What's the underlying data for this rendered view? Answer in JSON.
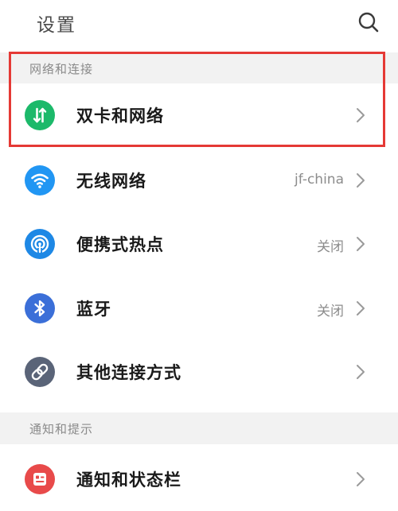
{
  "header": {
    "title": "设置",
    "search_icon": "search-icon"
  },
  "sections": [
    {
      "title": "网络和连接",
      "items": [
        {
          "label": "双卡和网络",
          "value": "",
          "icon": "dual-sim-data-icon",
          "icon_color": "#1cb96a"
        },
        {
          "label": "无线网络",
          "value": "jf-china",
          "icon": "wifi-icon",
          "icon_color": "#2196f3"
        },
        {
          "label": "便携式热点",
          "value": "关闭",
          "icon": "hotspot-icon",
          "icon_color": "#1e88e5"
        },
        {
          "label": "蓝牙",
          "value": "关闭",
          "icon": "bluetooth-icon",
          "icon_color": "#3b6fd8"
        },
        {
          "label": "其他连接方式",
          "value": "",
          "icon": "link-icon",
          "icon_color": "#5a6478"
        }
      ]
    },
    {
      "title": "通知和提示",
      "items": [
        {
          "label": "通知和状态栏",
          "value": "",
          "icon": "notification-icon",
          "icon_color": "#e84a4a"
        }
      ]
    }
  ],
  "highlight_color": "#e53935"
}
